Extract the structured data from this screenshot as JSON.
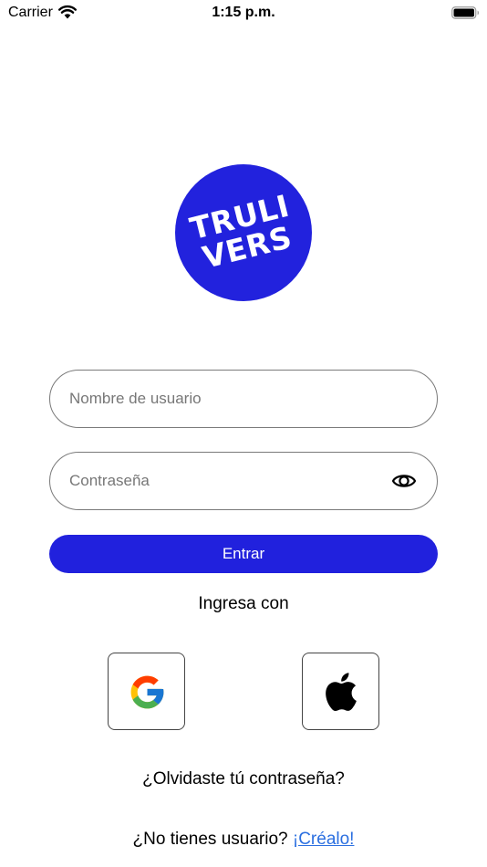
{
  "status_bar": {
    "carrier": "Carrier",
    "time": "1:15 p.m.",
    "wifi_icon": "wifi-icon",
    "battery_icon": "battery-icon"
  },
  "logo": {
    "line1": "TRULI",
    "line2": "VERS",
    "background_color": "#2222dd"
  },
  "login_form": {
    "username_placeholder": "Nombre de usuario",
    "username_value": "",
    "password_placeholder": "Contraseña",
    "password_value": "",
    "password_toggle_icon": "eye-icon",
    "submit_label": "Entrar",
    "submit_color": "#2121dd"
  },
  "social_login": {
    "label": "Ingresa con",
    "providers": [
      {
        "name": "google",
        "icon": "google-icon"
      },
      {
        "name": "apple",
        "icon": "apple-icon"
      }
    ]
  },
  "forgot_password": "¿Olvidaste tú contraseña?",
  "signup": {
    "prompt": "¿No tienes usuario?",
    "link": "¡Créalo!",
    "link_color": "#2b6fe0"
  }
}
